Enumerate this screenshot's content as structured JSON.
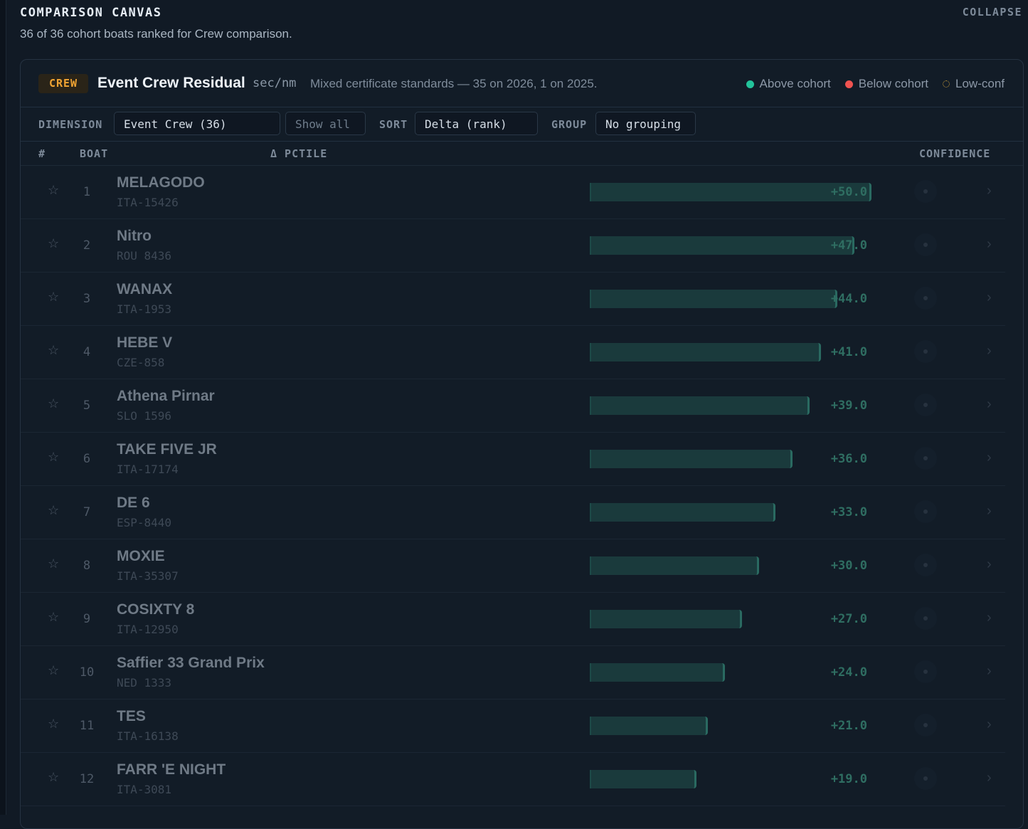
{
  "header": {
    "title": "COMPARISON CANVAS",
    "collapse_label": "COLLAPSE",
    "subtitle": "36 of 36 cohort boats ranked for Crew comparison."
  },
  "card": {
    "badge": "CREW",
    "metric_title": "Event Crew Residual",
    "unit": "sec/nm",
    "note": "Mixed certificate standards — 35 on 2026, 1 on 2025.",
    "legend": [
      {
        "label": "Above cohort",
        "color": "#22c39a"
      },
      {
        "label": "Below cohort",
        "color": "#ef5350"
      },
      {
        "label": "Low-conf",
        "color": "#c89a3a"
      }
    ]
  },
  "controls": {
    "dimension_label": "DIMENSION",
    "dimension_value": "Event Crew (36)",
    "show_all_label": "Show all",
    "sort_label": "SORT",
    "sort_value": "Delta (rank)",
    "group_label": "GROUP",
    "group_value": "No grouping"
  },
  "columns": {
    "rank": "#",
    "boat": "BOAT",
    "delta": "Δ PCTILE",
    "confidence": "CONFIDENCE"
  },
  "rows": [
    {
      "rank": "1",
      "name": "MELAGODO",
      "sail": "ITA-15426",
      "delta": "+50.0",
      "value": 50.0
    },
    {
      "rank": "2",
      "name": "Nitro",
      "sail": "ROU 8436",
      "delta": "+47.0",
      "value": 47.0
    },
    {
      "rank": "3",
      "name": "WANAX",
      "sail": "ITA-1953",
      "delta": "+44.0",
      "value": 44.0
    },
    {
      "rank": "4",
      "name": "HEBE V",
      "sail": "CZE-858",
      "delta": "+41.0",
      "value": 41.0
    },
    {
      "rank": "5",
      "name": "Athena Pirnar",
      "sail": "SLO 1596",
      "delta": "+39.0",
      "value": 39.0
    },
    {
      "rank": "6",
      "name": "TAKE FIVE JR",
      "sail": "ITA-17174",
      "delta": "+36.0",
      "value": 36.0
    },
    {
      "rank": "7",
      "name": "DE 6",
      "sail": "ESP-8440",
      "delta": "+33.0",
      "value": 33.0
    },
    {
      "rank": "8",
      "name": "MOXIE",
      "sail": "ITA-35307",
      "delta": "+30.0",
      "value": 30.0
    },
    {
      "rank": "9",
      "name": "COSIXTY 8",
      "sail": "ITA-12950",
      "delta": "+27.0",
      "value": 27.0
    },
    {
      "rank": "10",
      "name": "Saffier 33 Grand Prix",
      "sail": "NED 1333",
      "delta": "+24.0",
      "value": 24.0
    },
    {
      "rank": "11",
      "name": "TES",
      "sail": "ITA-16138",
      "delta": "+21.0",
      "value": 21.0
    },
    {
      "rank": "12",
      "name": "FARR 'E NIGHT",
      "sail": "ITA-3081",
      "delta": "+19.0",
      "value": 19.0
    }
  ],
  "icons": {
    "favorite": "star-outline-icon",
    "expand": "chevron-right-icon",
    "confidence": "confidence-dot-icon"
  }
}
